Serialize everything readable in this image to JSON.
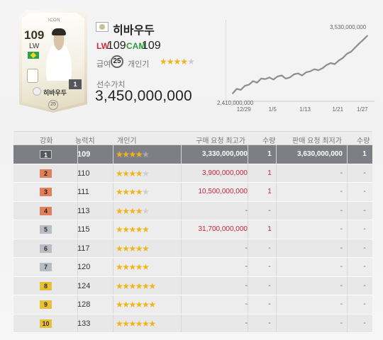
{
  "card": {
    "ovr": "109",
    "position": "LW",
    "season_label": "ICON",
    "level": "1",
    "name": "히바우두",
    "grade_badge": "25"
  },
  "player": {
    "name": "히바우두",
    "positions": [
      {
        "pos": "LW",
        "ovr": "109",
        "color": "#c3313b"
      },
      {
        "pos": "CAM",
        "ovr": "109",
        "color": "#2c9b3b"
      }
    ],
    "salary_label": "급여",
    "salary": "25",
    "skill_label": "개인기",
    "skill_stars": 4,
    "skill_max": 5,
    "value_label": "선수가치",
    "value": "3,450,000,000"
  },
  "chart_data": {
    "type": "line",
    "title": "",
    "x": [
      "12/26",
      "12/27",
      "12/28",
      "12/29",
      "12/30",
      "12/31",
      "1/1",
      "1/2",
      "1/3",
      "1/4",
      "1/5",
      "1/6",
      "1/7",
      "1/8",
      "1/9",
      "1/10",
      "1/11",
      "1/12",
      "1/13",
      "1/14",
      "1/15",
      "1/16",
      "1/17",
      "1/18",
      "1/19",
      "1/20",
      "1/21",
      "1/22",
      "1/23",
      "1/24",
      "1/25",
      "1/26",
      "1/27",
      "1/28"
    ],
    "xticks": [
      "12/29",
      "1/5",
      "1/13",
      "1/21",
      "1/27"
    ],
    "series": [
      {
        "values": [
          2410000000,
          2500000000,
          2480000000,
          2560000000,
          2580000000,
          2650000000,
          2620000000,
          2700000000,
          2690000000,
          2720000000,
          2680000000,
          2740000000,
          2760000000,
          2700000000,
          2720000000,
          2780000000,
          2800000000,
          2760000000,
          2820000000,
          2840000000,
          2880000000,
          2860000000,
          2900000000,
          2960000000,
          3000000000,
          2980000000,
          3050000000,
          3100000000,
          3180000000,
          3220000000,
          3300000000,
          3380000000,
          3450000000,
          3530000000
        ]
      }
    ],
    "annotations": {
      "min": "2,410,000,000",
      "max": "3,530,000,000"
    },
    "ylim": [
      2300000000,
      3700000000
    ],
    "grid": false,
    "line_color": "#8d8d8d"
  },
  "table": {
    "headers": {
      "grade": "강화",
      "ovr": "능력치",
      "skill": "개인기",
      "buy_max": "구매 요청 최고가",
      "buy_qty": "수량",
      "sell_min": "판매 요청 최저가",
      "sell_qty": "수량"
    },
    "rows": [
      {
        "grade": "1",
        "ovr": "109",
        "stars": 4,
        "buy_max": "3,330,000,000",
        "buy_qty": "1",
        "sell_min": "3,630,000,000",
        "sell_qty": "1",
        "selected": true
      },
      {
        "grade": "2",
        "ovr": "110",
        "stars": 4,
        "buy_max": "3,900,000,000",
        "buy_qty": "1",
        "sell_min": "-",
        "sell_qty": "-"
      },
      {
        "grade": "3",
        "ovr": "111",
        "stars": 4,
        "buy_max": "10,500,000,000",
        "buy_qty": "1",
        "sell_min": "-",
        "sell_qty": "-"
      },
      {
        "grade": "4",
        "ovr": "113",
        "stars": 4,
        "buy_max": "-",
        "buy_qty": "-",
        "sell_min": "-",
        "sell_qty": "-"
      },
      {
        "grade": "5",
        "ovr": "115",
        "stars": 5,
        "buy_max": "31,700,000,000",
        "buy_qty": "1",
        "sell_min": "-",
        "sell_qty": "-"
      },
      {
        "grade": "6",
        "ovr": "117",
        "stars": 5,
        "buy_max": "-",
        "buy_qty": "-",
        "sell_min": "-",
        "sell_qty": "-"
      },
      {
        "grade": "7",
        "ovr": "120",
        "stars": 5,
        "buy_max": "-",
        "buy_qty": "-",
        "sell_min": "-",
        "sell_qty": "-"
      },
      {
        "grade": "8",
        "ovr": "124",
        "stars": 6,
        "buy_max": "-",
        "buy_qty": "-",
        "sell_min": "-",
        "sell_qty": "-"
      },
      {
        "grade": "9",
        "ovr": "128",
        "stars": 6,
        "buy_max": "-",
        "buy_qty": "-",
        "sell_min": "-",
        "sell_qty": "-"
      },
      {
        "grade": "10",
        "ovr": "133",
        "stars": 6,
        "buy_max": "-",
        "buy_qty": "-",
        "sell_min": "-",
        "sell_qty": "-"
      }
    ]
  }
}
